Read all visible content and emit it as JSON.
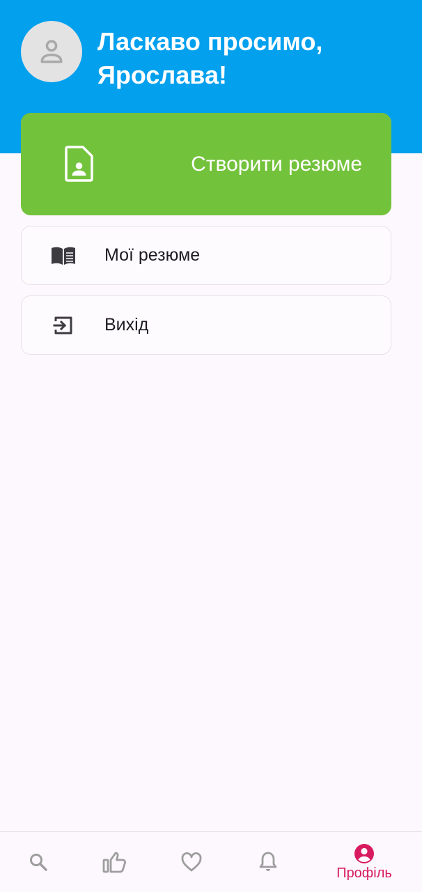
{
  "header": {
    "greeting": "Ласкаво просимо, Ярослава!",
    "background_color": "#03a0ee",
    "avatar_icon": "person-icon"
  },
  "create_resume": {
    "label": "Створити резюме",
    "icon": "resume-document-icon",
    "background_color": "#73c23c"
  },
  "menu": {
    "items": [
      {
        "label": "Мої резюме",
        "icon": "book-icon"
      },
      {
        "label": "Вихід",
        "icon": "logout-icon"
      }
    ]
  },
  "bottom_nav": {
    "items": [
      {
        "icon": "search-icon"
      },
      {
        "icon": "thumb-up-icon"
      },
      {
        "icon": "heart-icon"
      },
      {
        "icon": "bell-icon"
      },
      {
        "icon": "account-circle-icon",
        "label": "Профіль",
        "active": true
      }
    ],
    "active_color": "#d81b60",
    "inactive_color": "#9e9e9e"
  }
}
